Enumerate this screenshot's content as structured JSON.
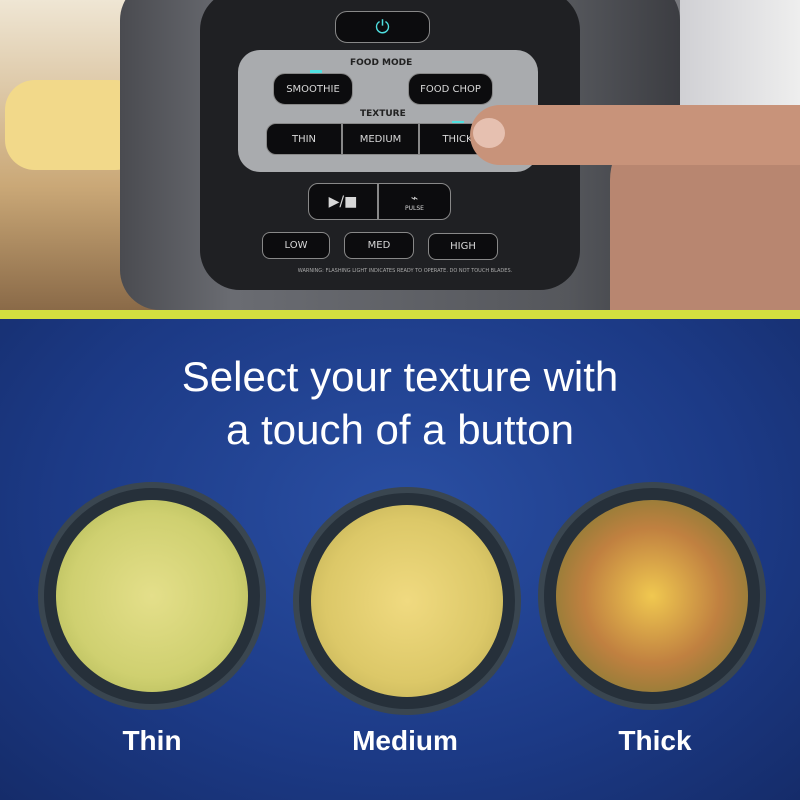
{
  "blender_panel": {
    "food_mode_label": "FOOD MODE",
    "texture_label": "TEXTURE",
    "food_modes": [
      "SMOOTHIE",
      "FOOD CHOP"
    ],
    "textures": [
      "THIN",
      "MEDIUM",
      "THICK"
    ],
    "pulse_label": "PULSE",
    "play_stop_label": "▶/■",
    "speeds": [
      "LOW",
      "MED",
      "HIGH"
    ],
    "warning": "WARNING: FLASHING LIGHT INDICATES READY TO OPERATE. DO NOT TOUCH BLADES.",
    "led_color": "#4fe0e0"
  },
  "headline": {
    "line1": "Select your texture with",
    "line2": "a touch of a button"
  },
  "bowls": [
    {
      "label": "Thin"
    },
    {
      "label": "Medium"
    },
    {
      "label": "Thick"
    }
  ],
  "colors": {
    "accent_stripe": "#d3df3f",
    "background": "#1c3a86"
  }
}
